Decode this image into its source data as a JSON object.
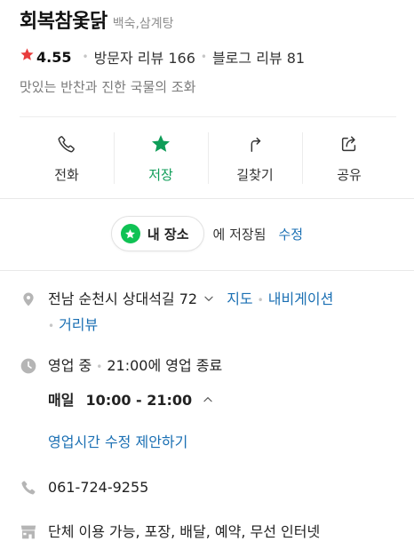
{
  "place": {
    "name": "회복참옻닭",
    "category": "백숙,삼계탕",
    "rating": "4.55",
    "visitor_reviews": "방문자 리뷰 166",
    "blog_reviews": "블로그 리뷰 81",
    "description": "맛있는 반찬과 진한 국물의 조화"
  },
  "actions": [
    {
      "label": "전화",
      "icon": "phone-icon"
    },
    {
      "label": "저장",
      "icon": "star-icon",
      "active": true
    },
    {
      "label": "길찾기",
      "icon": "directions-icon"
    },
    {
      "label": "공유",
      "icon": "share-icon"
    }
  ],
  "saved": {
    "label": "내 장소",
    "suffix": "에 저장됨",
    "edit": "수정"
  },
  "address": {
    "text": "전남 순천시 상대석길 72",
    "map_link": "지도",
    "nav_link": "내비게이션",
    "street_link": "거리뷰"
  },
  "hours": {
    "status": "영업 중",
    "close_info": "21:00에 영업 종료",
    "day": "매일",
    "time": "10:00 - 21:00",
    "suggest_link": "영업시간 수정 제안하기"
  },
  "phone": "061-724-9255",
  "amenities": "단체 이용 가능, 포장, 배달, 예약, 무선 인터넷",
  "colors": {
    "accent_green": "#0fc254",
    "link_blue": "#1a6fb3",
    "star_red": "#e83d3d"
  }
}
